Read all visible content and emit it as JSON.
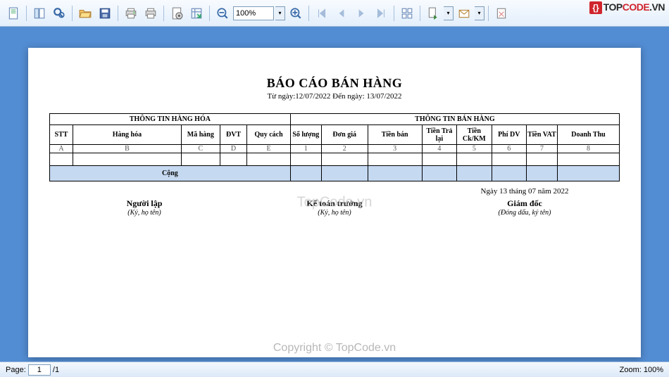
{
  "logo": {
    "brand1": "TOP",
    "brand2": "CODE",
    "suffix": ".VN",
    "glyph": "{}"
  },
  "toolbar": {
    "zoom_value": "100%"
  },
  "report": {
    "title": "BÁO CÁO BÁN HÀNG",
    "date_range": "Từ ngày:12/07/2022 Đến ngày: 13/07/2022",
    "group1": "THÔNG TIN HÀNG HÓA",
    "group2": "THÔNG TIN BÁN HÀNG",
    "cols": {
      "stt": "STT",
      "hh": "Hàng hóa",
      "mh": "Mã hàng",
      "dvt": "ĐVT",
      "qc": "Quy cách",
      "sl": "Số lượng",
      "dg": "Đơn giá",
      "tb": "Tiền bán",
      "ttl": "Tiền Trả lại",
      "ck": "Tiền Ck/KM",
      "pdv": "Phí DV",
      "vat": "Tiền VAT",
      "dt": "Doanh Thu"
    },
    "subcols": {
      "a": "A",
      "b": "B",
      "c": "C",
      "d": "D",
      "e": "E",
      "c1": "1",
      "c2": "2",
      "c3": "3",
      "c4": "4",
      "c5": "5",
      "c6": "6",
      "c7": "7",
      "c8": "8"
    },
    "total_label": "Cộng",
    "sig_date": "Ngày 13 tháng 07 năm 2022",
    "sigs": [
      {
        "role": "Người lập",
        "note": "(Ký, họ tên)"
      },
      {
        "role": "Kế toán trưởng",
        "note": "(Ký, họ tên)"
      },
      {
        "role": "Giám đốc",
        "note": "(Đóng dấu, ký tên)"
      }
    ]
  },
  "watermarks": {
    "w1": "TopCode.vn",
    "w2": "Copyright © TopCode.vn"
  },
  "status": {
    "page_label": "Page:",
    "page_current": "1",
    "page_sep": "/",
    "page_total": "1",
    "zoom_label": "Zoom:",
    "zoom_value": "100%"
  }
}
